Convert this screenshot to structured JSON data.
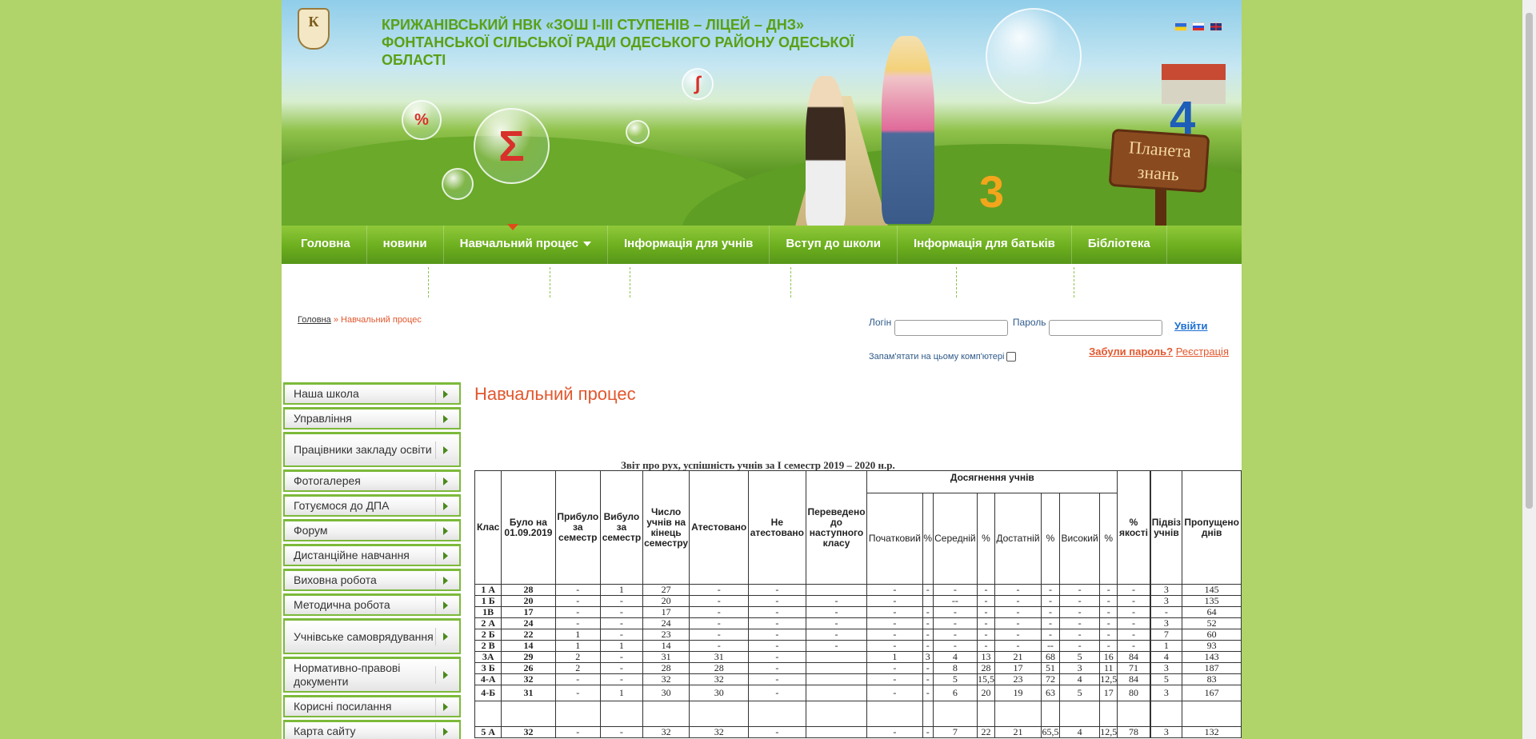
{
  "header": {
    "crest_text": "К",
    "title": "КРИЖАНІВСЬКИЙ НВК «ЗОШ I-III СТУПЕНІВ – ЛІЦЕЙ – ДНЗ» ФОНТАНСЬКОЇ СІЛЬСЬКОЇ РАДИ ОДЕСЬКОГО РАЙОНУ ОДЕСЬКОЇ ОБЛАСТІ",
    "banner_sign": "Планета знань",
    "colors": {
      "title": "#5aa015",
      "nav": "#6cae1e",
      "accent": "#e2572e"
    }
  },
  "nav": {
    "items": [
      "Головна",
      "новини",
      "Навчальний процес",
      "Інформація для учнів",
      "Вступ до школи",
      "Інформація для батьків",
      "Бібліотека"
    ]
  },
  "breadcrumb": {
    "home": "Головна",
    "sep": " » ",
    "current": "Навчальний процес"
  },
  "login": {
    "login_label": "Логін",
    "password_label": "Пароль",
    "submit": "Увійти",
    "remember": "Запам'ятати на цьому комп'ютері",
    "forgot": "Забули пароль?",
    "register": "Реєстрація"
  },
  "sidebar": {
    "items": [
      "Наша школа",
      "Управління",
      "Працівники закладу освіти",
      "Фотогалерея",
      "Готуємося до ДПА",
      "Форум",
      "Дистанційне навчання",
      "Виховна робота",
      "Методична робота",
      "Учнівське самоврядування",
      "Нормативно-правові документи",
      "Корисні посилання",
      "Карта сайту"
    ]
  },
  "content": {
    "page_title": "Навчальний процес",
    "report_title": "Звіт про рух, успішність учнів за І семестр  2019 – 2020 н.р.",
    "table": {
      "headers": {
        "klas": "Клас",
        "bulo": "Було на 01.09.2019",
        "prybulo": "Прибуло за семестр",
        "vybulo": "Вибуло за семестр",
        "chyslo": "Число учнів на кінець семестру",
        "atest": "Атестовано",
        "ne_atest": "Не атестовано",
        "perevedeno": "Переведено до наступного класу",
        "dosyagnennya": "Досягнення учнів",
        "pochatkovyi": "Початковий",
        "pct": "%",
        "serednii": "Середній",
        "dostatnii": "Достатній",
        "vysokyi": "Високий",
        "yakosti": "% якості",
        "pidviz": "Підвіз учнів",
        "propuscheno": "Пропущено днів"
      },
      "rows": [
        [
          "1 А",
          "28",
          "-",
          "1",
          "27",
          "-",
          "-",
          "",
          "-",
          "-",
          "-",
          "-",
          "-",
          "-",
          "-",
          "-",
          "-",
          "",
          "3",
          "145"
        ],
        [
          "1 Б",
          "20",
          "-",
          "-",
          "20",
          "-",
          "-",
          "-",
          "-",
          "",
          "--",
          "-",
          "-",
          "-",
          "-",
          "-",
          "-",
          "",
          "3",
          "135"
        ],
        [
          "1В",
          "17",
          "-",
          "-",
          "17",
          "-",
          "-",
          "-",
          "-",
          "-",
          "-",
          "-",
          "-",
          "-",
          "-",
          "-",
          "-",
          "",
          "-",
          "64"
        ],
        [
          "2 А",
          "24",
          "-",
          "-",
          "24",
          "-",
          "-",
          "-",
          "-",
          "-",
          "-",
          "-",
          "-",
          "-",
          "-",
          "-",
          "-",
          "",
          "3",
          "52"
        ],
        [
          "2 Б",
          "22",
          "1",
          "-",
          "23",
          "-",
          "-",
          "-",
          "-",
          "-",
          "-",
          "-",
          "-",
          "-",
          "-",
          "-",
          "-",
          "",
          "7",
          "60"
        ],
        [
          "2 В",
          "14",
          "1",
          "1",
          "14",
          "-",
          "-",
          "-",
          "-",
          "-",
          "-",
          "-",
          "-",
          "--",
          "-",
          "-",
          "-",
          "",
          "1",
          "93"
        ],
        [
          "3А",
          "29",
          "2",
          "-",
          "31",
          "31",
          "-",
          "",
          "1",
          "3",
          "4",
          "13",
          "21",
          "68",
          "5",
          "16",
          "84",
          "",
          "4",
          "143"
        ],
        [
          "3 Б",
          "26",
          "2",
          "-",
          "28",
          "28",
          "-",
          "",
          "-",
          "-",
          "8",
          "28",
          "17",
          "51",
          "3",
          "11",
          "71",
          "",
          "3",
          "187"
        ],
        [
          "4-А",
          "32",
          "-",
          "-",
          "32",
          "32",
          "-",
          "",
          "-",
          "-",
          "5",
          "15,5",
          "23",
          "72",
          "4",
          "12,5",
          "84",
          "",
          "5",
          "83"
        ],
        [
          "4-Б",
          "31",
          "-",
          "1",
          "30",
          "30",
          "-",
          "",
          "-",
          "-",
          "6",
          "20",
          "19",
          "63",
          "5",
          "17",
          "80",
          "",
          "3",
          "167"
        ],
        [
          "",
          "",
          "",
          "",
          "",
          "",
          "",
          "",
          "",
          "",
          "",
          "",
          "",
          "",
          "",
          "",
          "",
          "",
          "",
          ""
        ],
        [
          "5 А",
          "32",
          "-",
          "-",
          "32",
          "32",
          "-",
          "",
          "-",
          "-",
          "7",
          "22",
          "21",
          "65,5",
          "4",
          "12,5",
          "78",
          "",
          "3",
          "132"
        ]
      ]
    }
  }
}
